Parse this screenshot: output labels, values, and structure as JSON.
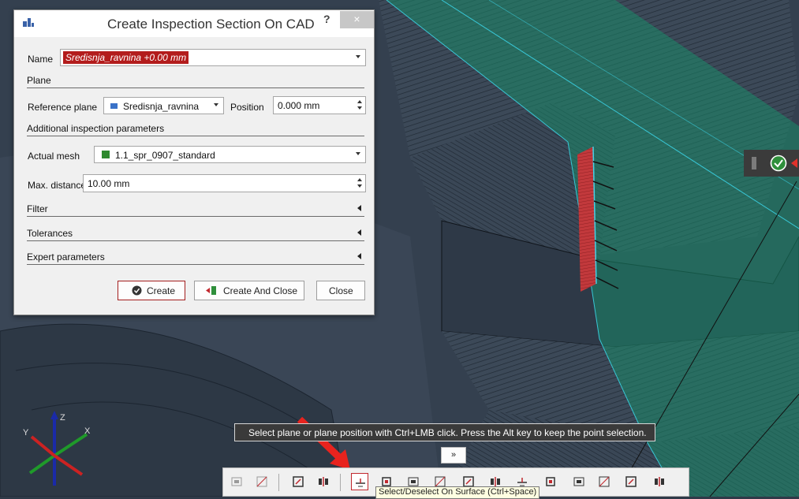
{
  "dialog": {
    "title": "Create Inspection Section On CAD",
    "help": "?",
    "close": "×",
    "name_label": "Name",
    "name_value": "Sredisnja_ravnina +0.00 mm",
    "plane_header": "Plane",
    "reference_plane_label": "Reference plane",
    "reference_plane_value": "Sredisnja_ravnina",
    "position_label": "Position",
    "position_value": "0.000 mm",
    "additional_header": "Additional inspection parameters",
    "actual_mesh_label": "Actual mesh",
    "actual_mesh_value": "1.1_spr_0907_standard",
    "max_distance_label": "Max. distance",
    "max_distance_value": "10.00 mm",
    "filter_label": "Filter",
    "tolerances_label": "Tolerances",
    "expert_label": "Expert parameters",
    "create_button": "Create",
    "create_close_button": "Create And Close",
    "close_button": "Close"
  },
  "status_hint": "Select plane or plane position with Ctrl+LMB click. Press the Alt key to keep the point selection.",
  "expand_glyph": "»",
  "tooltip": "Select/Deselect On Surface (Ctrl+Space)",
  "axes": {
    "x": "X",
    "y": "Y",
    "z": "Z"
  },
  "toolbar_icons": [
    "select-visible-icon",
    "deselect-icon",
    "invert-selection-icon",
    "select-through-icon",
    "select-on-surface-icon",
    "deselect-on-surface-icon",
    "select-patch-icon",
    "select-rectangle-icon",
    "select-polygon-icon",
    "select-lasso-icon",
    "select-connected-icon",
    "select-grid-icon",
    "select-bounded-icon",
    "select-all-icon",
    "deselect-all-icon",
    "selection-options-icon"
  ],
  "colors": {
    "accent_red": "#c1272d",
    "surface_green": "#1a8a6a",
    "mesh_dark": "#3f4d5e",
    "background": "#2f3a48"
  }
}
